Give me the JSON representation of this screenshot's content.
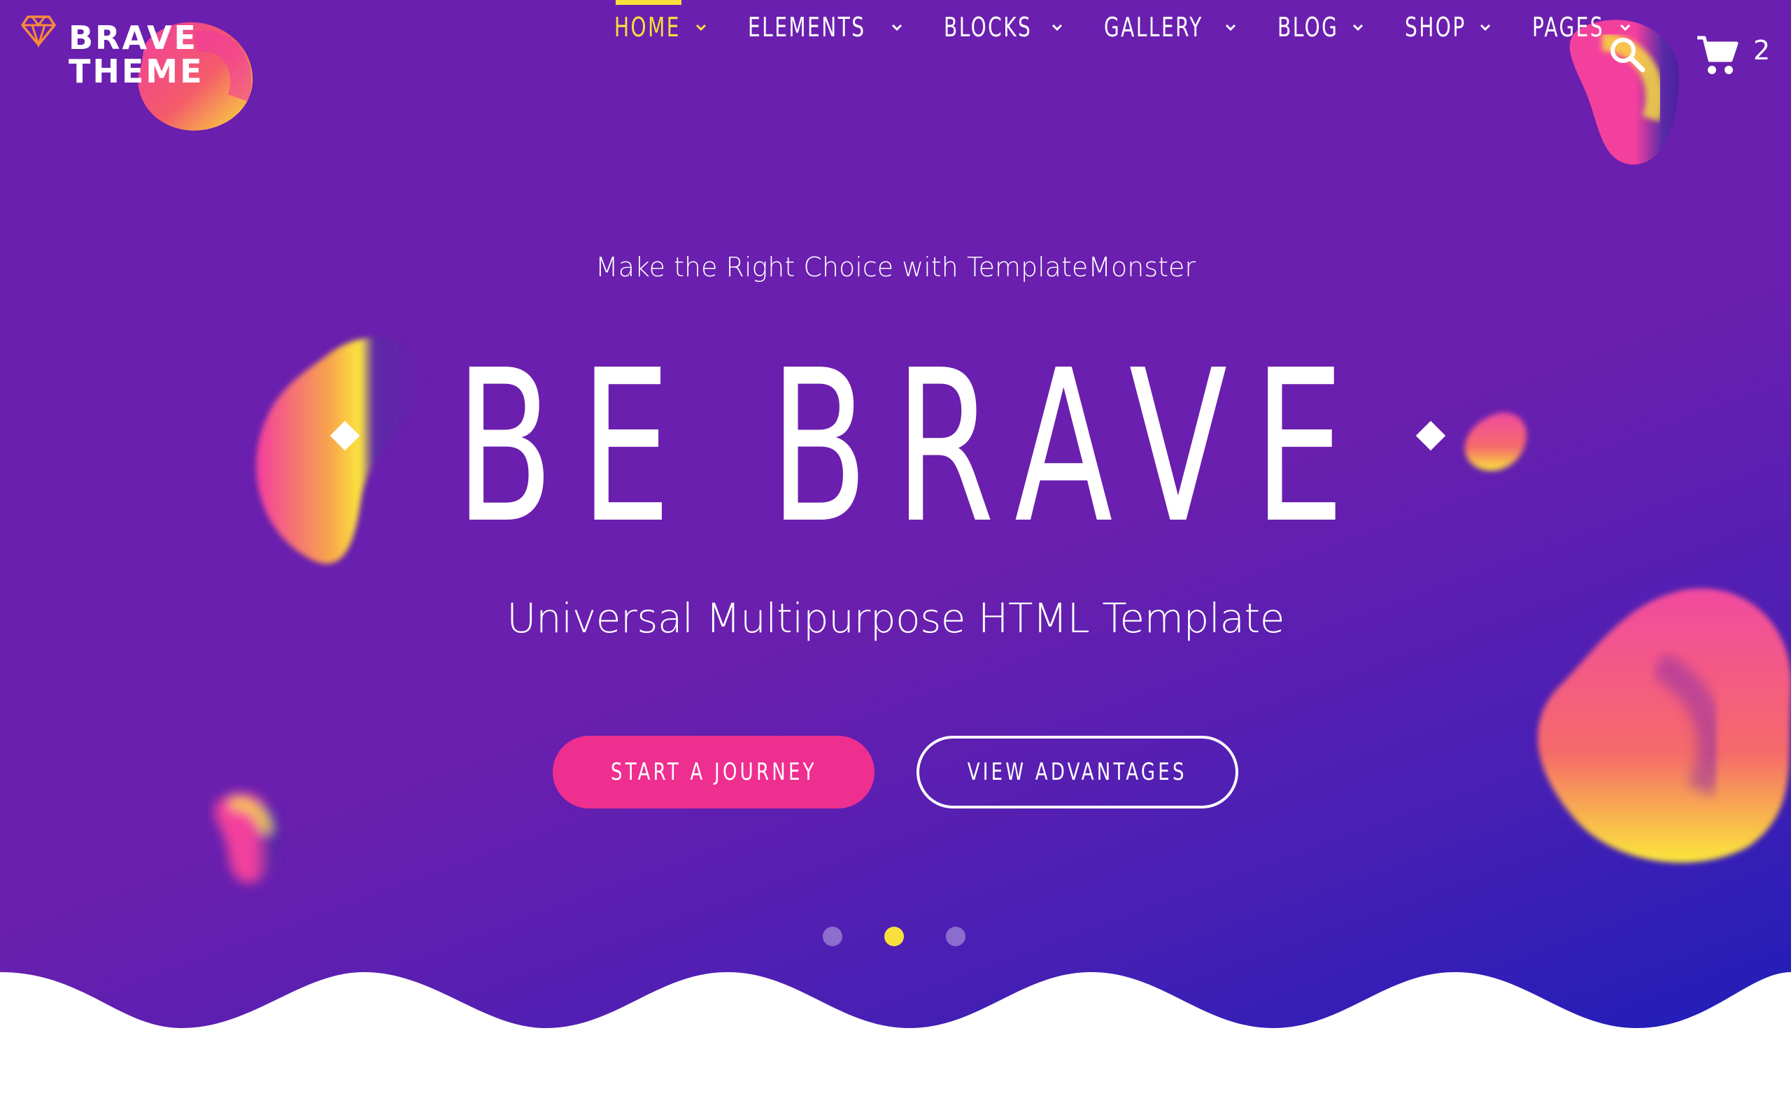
{
  "brand": {
    "logo_line1": "BRAVE",
    "logo_line2": "THEME",
    "logo_icon": "diamond-icon"
  },
  "nav": {
    "items": [
      {
        "label": "HOME",
        "active": true
      },
      {
        "label": "ELEMENTS",
        "active": false
      },
      {
        "label": "BLOCKS",
        "active": false
      },
      {
        "label": "GALLERY",
        "active": false
      },
      {
        "label": "BLOG",
        "active": false
      },
      {
        "label": "SHOP",
        "active": false
      },
      {
        "label": "PAGES",
        "active": false
      }
    ],
    "search_icon": "search-icon",
    "cart_icon": "cart-icon",
    "cart_count": "2"
  },
  "hero": {
    "subtitle": "Make the Right Choice with TemplateMonster",
    "headline": "BE BRAVE",
    "tagline": "Universal Multipurpose HTML Template",
    "primary_button": "START A JOURNEY",
    "secondary_button": "VIEW ADVANTAGES",
    "slides": 3,
    "active_slide": 2
  },
  "colors": {
    "background_purple": "#6a1fae",
    "background_blue": "#1e1eb8",
    "accent_yellow": "#f7e03c",
    "accent_pink": "#ee2f8f",
    "text": "#ffffff"
  }
}
